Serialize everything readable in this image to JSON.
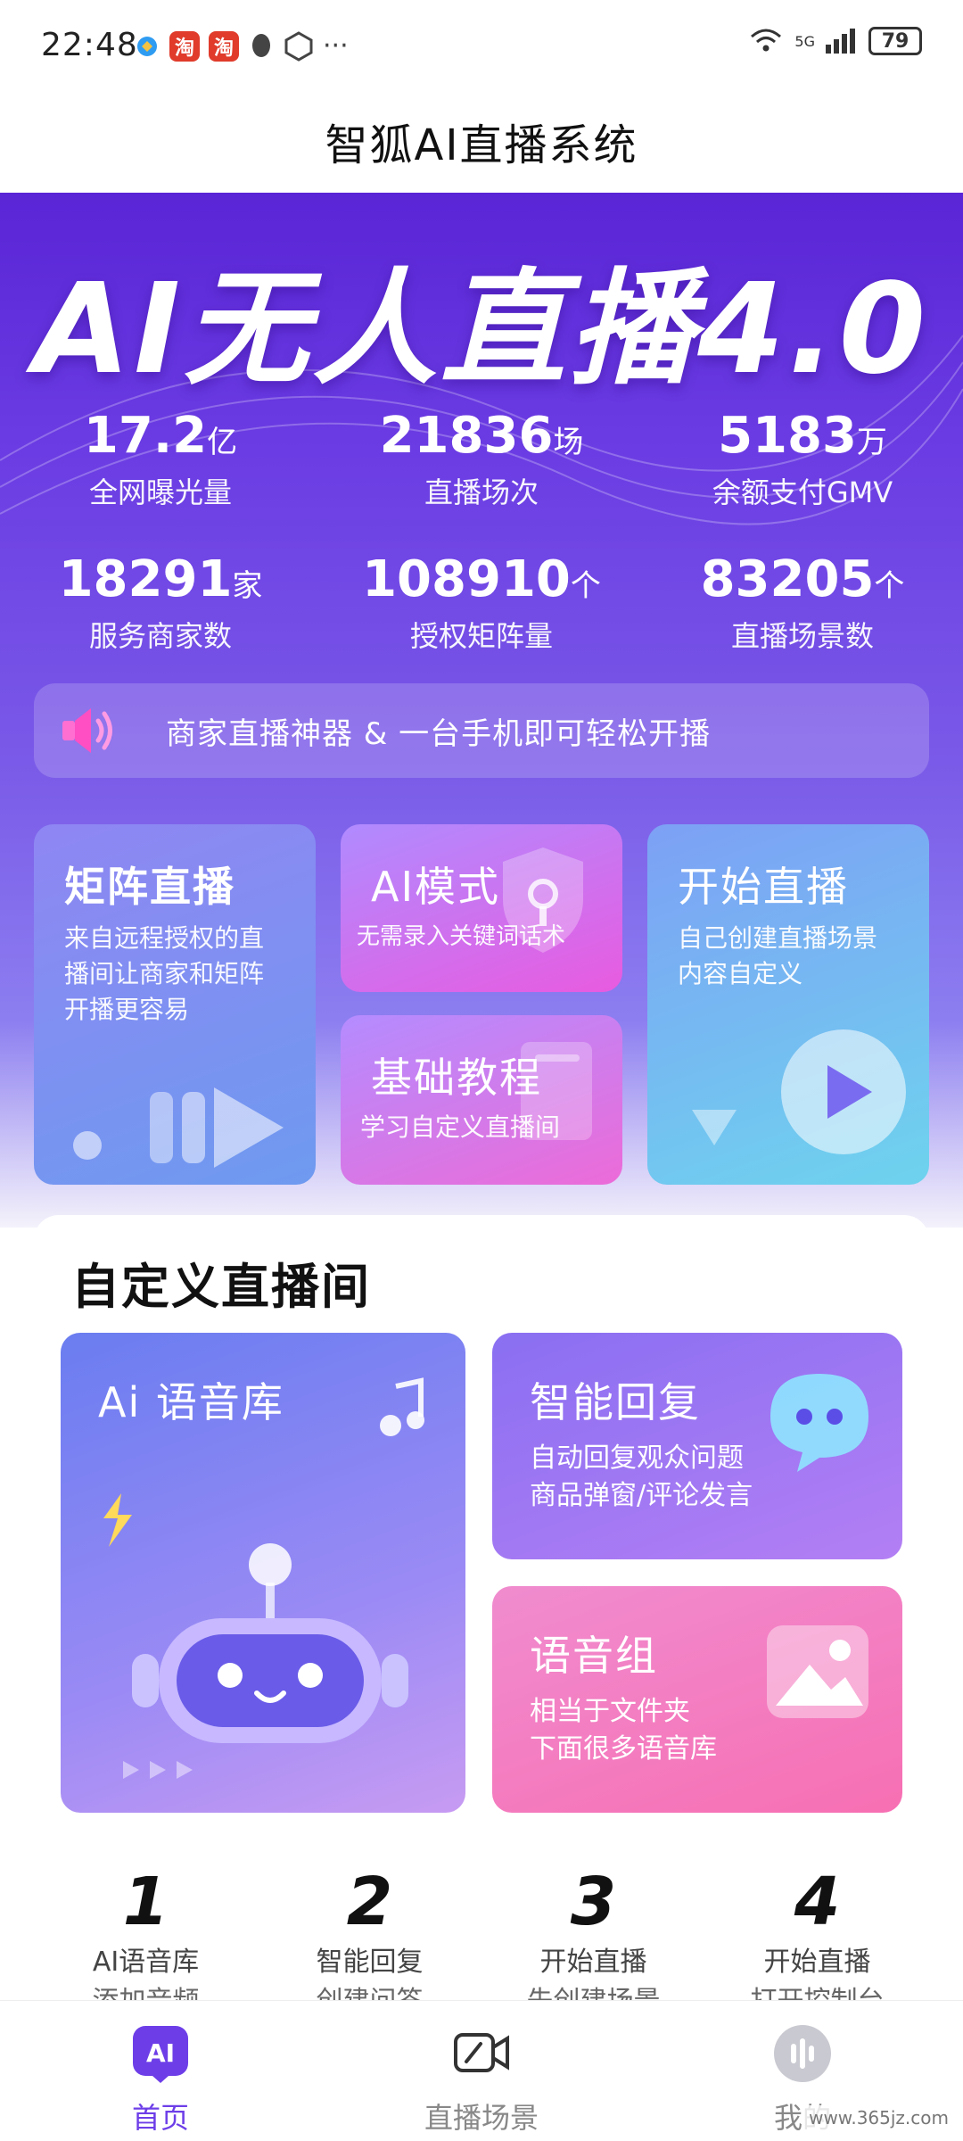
{
  "status_bar": {
    "time": "22:48",
    "network": "5G",
    "battery": "79",
    "app_badge": "淘",
    "more": "···"
  },
  "header": {
    "title": "智狐AI直播系统"
  },
  "hero": {
    "title": "AI无人直播4.0",
    "stats": [
      {
        "value": "17.2",
        "unit": "亿",
        "label": "全网曝光量"
      },
      {
        "value": "21836",
        "unit": "场",
        "label": "直播场次"
      },
      {
        "value": "5183",
        "unit": "万",
        "label": "余额支付GMV"
      },
      {
        "value": "18291",
        "unit": "家",
        "label": "服务商家数"
      },
      {
        "value": "108910",
        "unit": "个",
        "label": "授权矩阵量"
      },
      {
        "value": "83205",
        "unit": "个",
        "label": "直播场景数"
      }
    ],
    "notice": "商家直播神器 & 一台手机即可轻松开播"
  },
  "features": {
    "matrix": {
      "title": "矩阵直播",
      "desc": [
        "来自远程授权的直",
        "播间让商家和矩阵",
        "开播更容易"
      ]
    },
    "ai_mode": {
      "title": "AI模式",
      "desc": "无需录入关键词话术"
    },
    "basic": {
      "title": "基础教程",
      "desc": "学习自定义直播间"
    },
    "start": {
      "title": "开始直播",
      "desc": [
        "自己创建直播场景",
        "内容自定义"
      ]
    }
  },
  "custom": {
    "title": "自定义直播间",
    "voice_lib": {
      "title": "Ai 语音库"
    },
    "smart_reply": {
      "title": "智能回复",
      "desc": [
        "自动回复观众问题",
        "商品弹窗/评论发言"
      ]
    },
    "voice_group": {
      "title": "语音组",
      "desc": [
        "相当于文件夹",
        "下面很多语音库"
      ]
    },
    "steps": [
      {
        "num": "1",
        "title": "AI语音库",
        "sub": "添加音频"
      },
      {
        "num": "2",
        "title": "智能回复",
        "sub": "创建问答"
      },
      {
        "num": "3",
        "title": "开始直播",
        "sub": "先创建场景"
      },
      {
        "num": "4",
        "title": "开始直播",
        "sub": "打开控制台"
      }
    ]
  },
  "nav": {
    "items": [
      {
        "label": "首页",
        "icon": "ai-home-icon"
      },
      {
        "label": "直播场景",
        "icon": "video-scene-icon"
      },
      {
        "label": "我的",
        "icon": "profile-icon"
      }
    ],
    "active_color": "#6d3ee8"
  },
  "watermark": "www.365jz.com"
}
